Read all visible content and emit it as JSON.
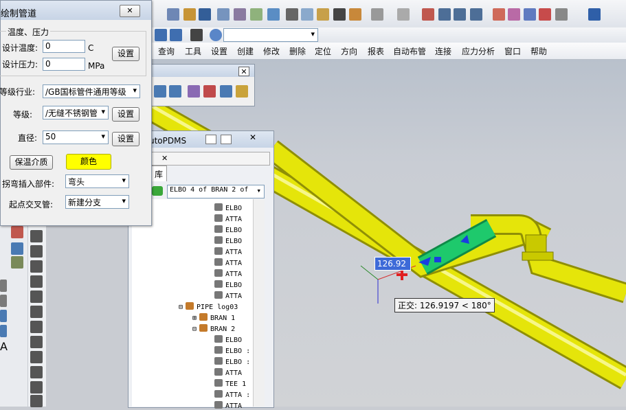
{
  "menu": [
    "查询",
    "工具",
    "设置",
    "创建",
    "修改",
    "删除",
    "定位",
    "方向",
    "报表",
    "自动布管",
    "连接",
    "应力分析",
    "窗口",
    "帮助"
  ],
  "dialog": {
    "title": "绘制管道",
    "group": "温度、压力",
    "temp_label": "设计温度:",
    "temp_value": "0",
    "temp_unit": "C",
    "pressure_label": "设计压力:",
    "pressure_value": "0",
    "pressure_unit": "MPa",
    "settings_label": "设置",
    "industry_label": "等级行业:",
    "industry_value": "/GB国标管件通用等级",
    "grade_label": "等级:",
    "grade_value": "/无缝不锈钢管",
    "diameter_label": "直径:",
    "diameter_value": "50",
    "insulation_btn": "保温介质",
    "color_btn": "颜色",
    "bend_label": "拐弯插入部件:",
    "bend_value": "弯头",
    "start_label": "起点交叉管:",
    "start_value": "新建分支",
    "close": "X"
  },
  "tree_window": {
    "title": "utoPDMS",
    "tab": "库",
    "selector": "ELBO 4 of BRAN 2 of",
    "items": [
      "ELBO",
      "ATTA",
      "ELBO",
      "ELBO",
      "ATTA",
      "ATTA",
      "ATTA",
      "ELBO",
      "ATTA",
      "PIPE log03",
      "BRAN 1",
      "BRAN 2",
      "ELBO",
      "ELBO :",
      "ELBO :",
      "ATTA",
      "TEE 1",
      "ATTA :",
      "ATTA"
    ]
  },
  "dimension_value": "126.92",
  "tooltip": "正交: 126.9197 < 180°",
  "colors": {
    "pipe": "#e5e50a",
    "selected": "#1ec96c",
    "dimbox": "#3d6ad8"
  }
}
